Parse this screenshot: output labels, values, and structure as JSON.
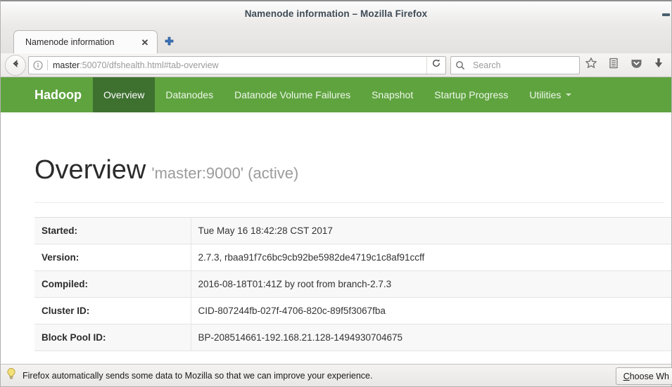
{
  "window": {
    "title": "Namenode information – Mozilla Firefox",
    "minimize_label": "minimize"
  },
  "tabs": [
    {
      "title": "Namenode information",
      "close_label": "✕"
    }
  ],
  "newtab": {
    "label": "+"
  },
  "toolbar": {
    "back_label": "Back",
    "url_domain": "master",
    "url_rest": ":50070/dfshealth.html#tab-overview",
    "reload_label": "Reload",
    "search_placeholder": "Search",
    "icons": [
      "star-icon",
      "library-icon",
      "pocket-icon",
      "download-icon"
    ]
  },
  "hadoop": {
    "brand": "Hadoop",
    "nav": [
      {
        "label": "Overview",
        "active": true
      },
      {
        "label": "Datanodes",
        "active": false
      },
      {
        "label": "Datanode Volume Failures",
        "active": false
      },
      {
        "label": "Snapshot",
        "active": false
      },
      {
        "label": "Startup Progress",
        "active": false
      },
      {
        "label": "Utilities",
        "active": false,
        "caret": true
      }
    ],
    "nav_bg": "#5fa33f",
    "nav_active_bg": "#3e7030"
  },
  "page": {
    "title": "Overview",
    "subtitle": "'master:9000' (active)",
    "table": {
      "rows": [
        {
          "label": "Started:",
          "value": "Tue May 16 18:42:28 CST 2017"
        },
        {
          "label": "Version:",
          "value": "2.7.3, rbaa91f7c6bc9cb92be5982de4719c1c8af91ccff"
        },
        {
          "label": "Compiled:",
          "value": "2016-08-18T01:41Z by root from branch-2.7.3"
        },
        {
          "label": "Cluster ID:",
          "value": "CID-807244fb-027f-4706-820c-89f5f3067fba"
        },
        {
          "label": "Block Pool ID:",
          "value": "BP-208514661-192.168.21.128-1494930704675"
        }
      ]
    }
  },
  "notification": {
    "text": "Firefox automatically sends some data to Mozilla so that we can improve your experience.",
    "button_prefix": "C",
    "button_suffix": "hoose Wh"
  }
}
